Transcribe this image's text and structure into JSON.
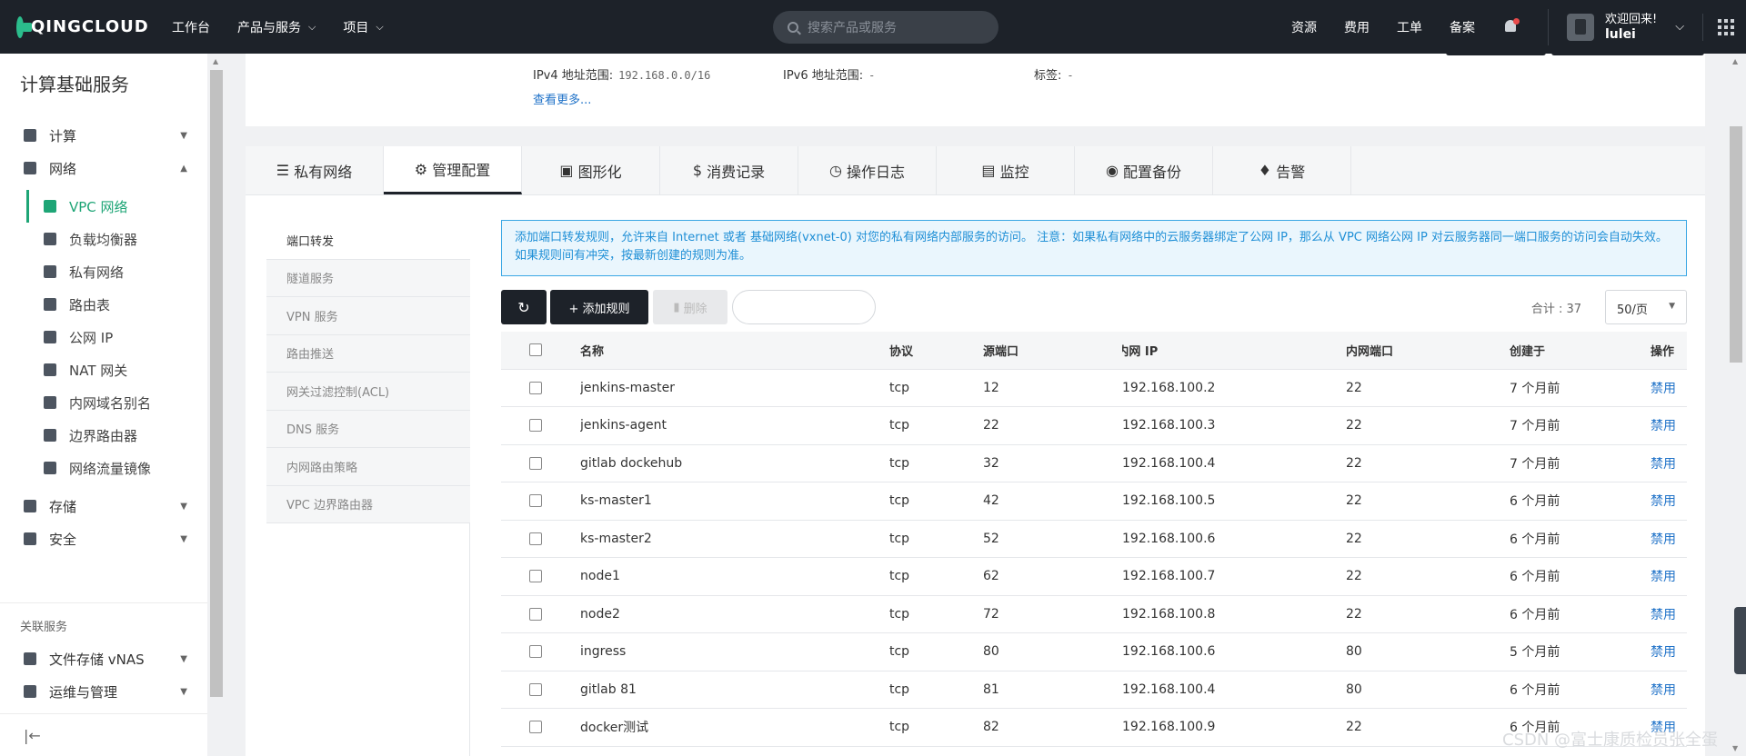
{
  "topbar": {
    "logo_text": "QINGCLOUD",
    "nav": [
      {
        "label": "工作台",
        "has_menu": false
      },
      {
        "label": "产品与服务",
        "has_menu": true
      },
      {
        "label": "项目",
        "has_menu": true
      }
    ],
    "search_placeholder": "搜索产品或服务",
    "right_links": [
      "资源",
      "费用",
      "工单",
      "备案"
    ],
    "welcome": "欢迎回来!",
    "username": "lulei"
  },
  "sidebar": {
    "title": "计算基础服务",
    "groups": [
      {
        "label": "计算",
        "icon": "compute-icon",
        "expanded": false
      },
      {
        "label": "网络",
        "icon": "network-icon",
        "expanded": true
      }
    ],
    "network_items": [
      {
        "label": "VPC 网络",
        "icon": "vpc-icon",
        "active": true
      },
      {
        "label": "负载均衡器",
        "icon": "load-balancer-icon",
        "active": false
      },
      {
        "label": "私有网络",
        "icon": "wifi-icon",
        "active": false
      },
      {
        "label": "路由表",
        "icon": "route-table-icon",
        "active": false
      },
      {
        "label": "公网 IP",
        "icon": "ip-icon",
        "active": false
      },
      {
        "label": "NAT 网关",
        "icon": "globe-icon",
        "active": false
      },
      {
        "label": "内网域名别名",
        "icon": "dns-alias-icon",
        "active": false
      },
      {
        "label": "边界路由器",
        "icon": "border-router-icon",
        "active": false
      },
      {
        "label": "网络流量镜像",
        "icon": "traffic-mirror-icon",
        "active": false
      }
    ],
    "groups_after": [
      {
        "label": "存储",
        "icon": "storage-icon"
      },
      {
        "label": "安全",
        "icon": "shield-icon"
      }
    ],
    "related_title": "关联服务",
    "related": [
      {
        "label": "文件存储 vNAS",
        "icon": "folder-icon"
      },
      {
        "label": "运维与管理",
        "icon": "ops-icon"
      }
    ]
  },
  "info": {
    "ipv4_label": "IPv4 地址范围:",
    "ipv4_value": "192.168.0.0/16",
    "ipv6_label": "IPv6 地址范围:",
    "ipv6_value": "-",
    "tags_label": "标签:",
    "tags_value": "-",
    "more_link": "查看更多..."
  },
  "tabs": [
    {
      "label": "私有网络",
      "icon": "list-icon",
      "active": false
    },
    {
      "label": "管理配置",
      "icon": "gears-icon",
      "active": true
    },
    {
      "label": "图形化",
      "icon": "image-icon",
      "active": false
    },
    {
      "label": "消费记录",
      "icon": "dollar-icon",
      "active": false
    },
    {
      "label": "操作日志",
      "icon": "clock-icon",
      "active": false
    },
    {
      "label": "监控",
      "icon": "chart-icon",
      "active": false
    },
    {
      "label": "配置备份",
      "icon": "camera-icon",
      "active": false
    },
    {
      "label": "告警",
      "icon": "bell-icon",
      "active": false
    }
  ],
  "subnav": [
    {
      "label": "端口转发",
      "active": true
    },
    {
      "label": "隧道服务",
      "active": false
    },
    {
      "label": "VPN 服务",
      "active": false
    },
    {
      "label": "路由推送",
      "active": false
    },
    {
      "label": "网关过滤控制(ACL)",
      "active": false
    },
    {
      "label": "DNS 服务",
      "active": false
    },
    {
      "label": "内网路由策略",
      "active": false
    },
    {
      "label": "VPC 边界路由器",
      "active": false
    }
  ],
  "notice": "添加端口转发规则，允许来自 Internet 或者 基础网络(vxnet-0) 对您的私有网络内部服务的访问。 注意：如果私有网络中的云服务器绑定了公网 IP，那么从 VPC 网络公网 IP 对云服务器同一端口服务的访问会自动失效。 如果规则间有冲突，按最新创建的规则为准。",
  "toolbar": {
    "refresh_icon": "↻",
    "add_label": "+ 添加规则",
    "delete_label": "删除",
    "total_label": "合计 : 37",
    "page_size": "50/页"
  },
  "table": {
    "headers": {
      "name": "名称",
      "protocol": "协议",
      "src_port": "源端口",
      "internal_ip": "内网 IP",
      "internal_port": "内网端口",
      "created": "创建于",
      "op": "操作"
    },
    "rows": [
      {
        "name": "jenkins-master",
        "protocol": "tcp",
        "src_port": "12",
        "internal_ip": "192.168.100.2",
        "internal_port": "22",
        "created": "7 个月前",
        "op": "禁用"
      },
      {
        "name": "jenkins-agent",
        "protocol": "tcp",
        "src_port": "22",
        "internal_ip": "192.168.100.3",
        "internal_port": "22",
        "created": "7 个月前",
        "op": "禁用"
      },
      {
        "name": "gitlab dockehub",
        "protocol": "tcp",
        "src_port": "32",
        "internal_ip": "192.168.100.4",
        "internal_port": "22",
        "created": "7 个月前",
        "op": "禁用"
      },
      {
        "name": "ks-master1",
        "protocol": "tcp",
        "src_port": "42",
        "internal_ip": "192.168.100.5",
        "internal_port": "22",
        "created": "6 个月前",
        "op": "禁用"
      },
      {
        "name": "ks-master2",
        "protocol": "tcp",
        "src_port": "52",
        "internal_ip": "192.168.100.6",
        "internal_port": "22",
        "created": "6 个月前",
        "op": "禁用"
      },
      {
        "name": "node1",
        "protocol": "tcp",
        "src_port": "62",
        "internal_ip": "192.168.100.7",
        "internal_port": "22",
        "created": "6 个月前",
        "op": "禁用"
      },
      {
        "name": "node2",
        "protocol": "tcp",
        "src_port": "72",
        "internal_ip": "192.168.100.8",
        "internal_port": "22",
        "created": "6 个月前",
        "op": "禁用"
      },
      {
        "name": "ingress",
        "protocol": "tcp",
        "src_port": "80",
        "internal_ip": "192.168.100.6",
        "internal_port": "80",
        "created": "5 个月前",
        "op": "禁用"
      },
      {
        "name": "gitlab 81",
        "protocol": "tcp",
        "src_port": "81",
        "internal_ip": "192.168.100.4",
        "internal_port": "80",
        "created": "6 个月前",
        "op": "禁用"
      },
      {
        "name": "docker测试",
        "protocol": "tcp",
        "src_port": "82",
        "internal_ip": "192.168.100.9",
        "internal_port": "22",
        "created": "6 个月前",
        "op": "禁用"
      }
    ]
  },
  "watermark": "CSDN @富士康质检员张全蛋"
}
